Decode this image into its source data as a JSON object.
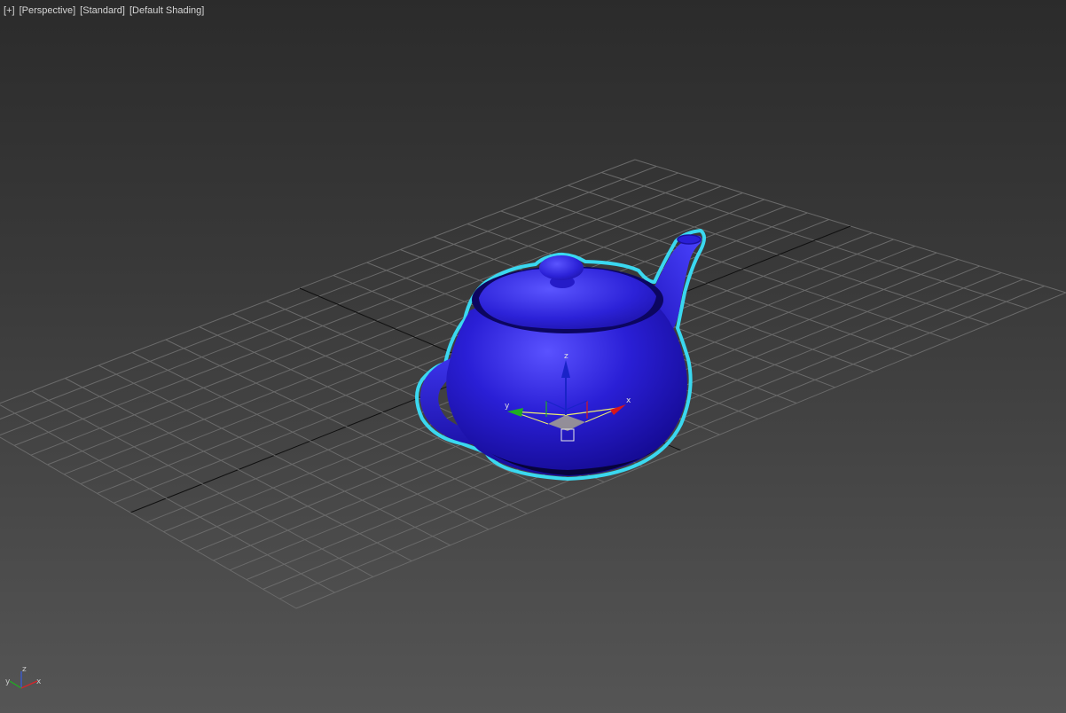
{
  "viewport": {
    "menu_plus": "+",
    "view": "Perspective",
    "visual_style": "Standard",
    "shading": "Default Shading"
  },
  "object": {
    "type": "teapot",
    "color": "#2a1fd6",
    "selection_outline_color": "#3ad8f0",
    "selected": true
  },
  "gizmo": {
    "x_label": "x",
    "y_label": "y",
    "z_label": "z",
    "x_color": "#d8161c",
    "y_color": "#1fae21",
    "z_color": "#1a23c8",
    "plane_color": "#ecec70"
  },
  "axis_tripod": {
    "x_label": "x",
    "y_label": "y",
    "z_label": "z"
  },
  "grid": {
    "visible": true,
    "line_color": "#6a6a6a",
    "axis_line_color": "#101010"
  }
}
